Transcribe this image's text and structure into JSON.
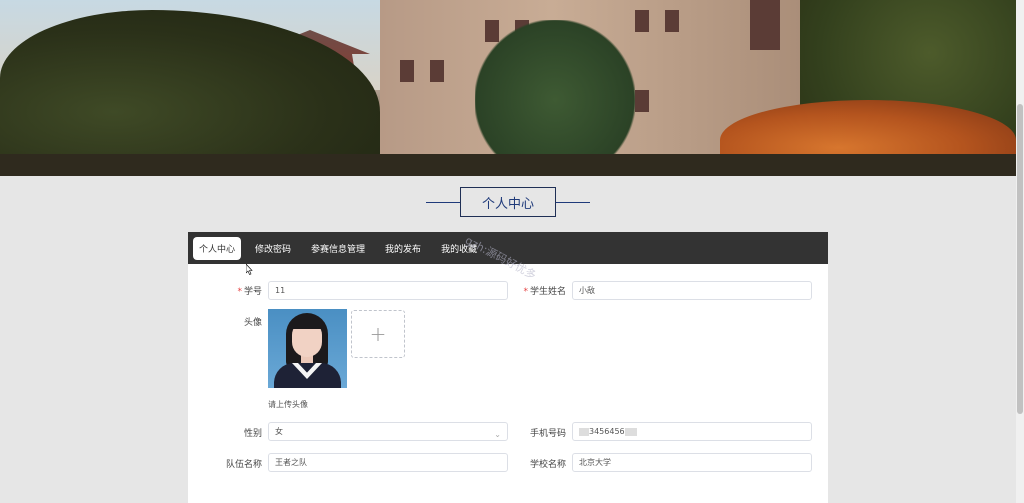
{
  "page_title": "个人中心",
  "tabs": [
    {
      "label": "个人中心",
      "active": true
    },
    {
      "label": "修改密码",
      "active": false
    },
    {
      "label": "参赛信息管理",
      "active": false
    },
    {
      "label": "我的发布",
      "active": false
    },
    {
      "label": "我的收藏",
      "active": false
    }
  ],
  "watermark": "gzh:源码好优多",
  "form": {
    "student_id": {
      "label": "学号",
      "required": true,
      "value": "11"
    },
    "student_name": {
      "label": "学生姓名",
      "required": true,
      "value": "小敌"
    },
    "avatar": {
      "label": "头像",
      "hint": "请上传头像",
      "add_symbol": "+"
    },
    "gender": {
      "label": "性别",
      "value": "女"
    },
    "phone": {
      "label": "手机号码",
      "value": "3456456"
    },
    "team": {
      "label": "队伍名称",
      "value": "王者之队"
    },
    "school": {
      "label": "学校名称",
      "value": "北京大学"
    }
  },
  "colors": {
    "tab_bar": "#333333",
    "title_accent": "#1f3a7a",
    "required": "#e54545"
  }
}
